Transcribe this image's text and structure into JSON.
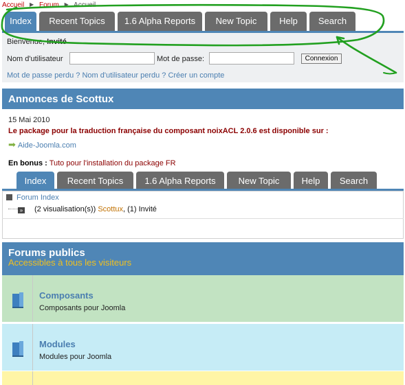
{
  "breadcrumb": {
    "items": [
      "Accueil",
      "Forum",
      "Accueil"
    ]
  },
  "tabs": [
    "Index",
    "Recent Topics",
    "1.6 Alpha Reports",
    "New Topic",
    "Help",
    "Search"
  ],
  "login": {
    "welcome_prefix": "Bienvenue, ",
    "welcome_user": "Invité",
    "username_label": "Nom d'utilisateur",
    "password_label": "Mot de passe:",
    "username_value": "",
    "password_value": "",
    "button_label": "Connexion",
    "links": "Mot de passe perdu ? Nom d'utilisateur perdu ? Créer un compte"
  },
  "announcement": {
    "title": "Annonces de Scottux",
    "date": "15 Mai 2010",
    "message": "Le package pour la traduction française du composant noixACL 2.0.6 est disponible sur :",
    "link": "Aide-Joomla.com",
    "bonus_label": "En bonus :",
    "bonus_link": "Tuto pour l'installation du package FR"
  },
  "whos_online": {
    "forum_index": "Forum Index",
    "views_text": "(2 visualisation(s))",
    "user": "Scottux",
    "guests": ", (1) Invité"
  },
  "forums": {
    "title": "Forums publics",
    "subtitle": "Accessibles à tous les visiteurs",
    "items": [
      {
        "name": "Composants",
        "desc": "Composants pour Joomla"
      },
      {
        "name": "Modules",
        "desc": "Modules pour Joomla"
      }
    ]
  },
  "colors": {
    "tab_active": "#4f86b6",
    "tab_inactive": "#6b6b6b",
    "header": "#4f86b6",
    "annotation": "#22a020",
    "row_green": "#c2e3c2",
    "row_blue": "#c6ecf6",
    "row_yellow": "#fff5a6"
  }
}
